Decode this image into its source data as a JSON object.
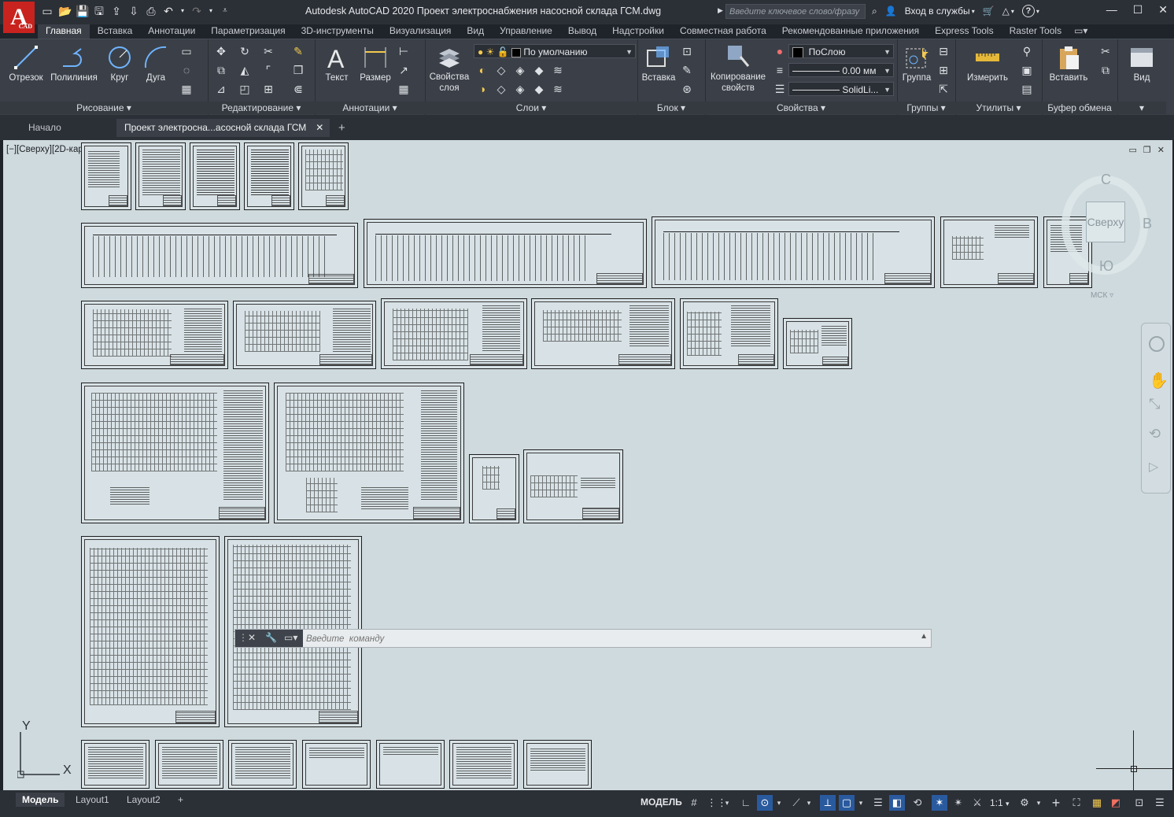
{
  "app": {
    "logo_letter": "A",
    "logo_sub": "CAD",
    "title": "Autodesk AutoCAD 2020   Проект электроснабжения насосной склада ГСМ.dwg",
    "search_placeholder": "Введите ключевое слово/фразу",
    "signin": "Вход в службы",
    "accent": "#2a5a9e"
  },
  "ribbon_tabs": [
    "Главная",
    "Вставка",
    "Аннотации",
    "Параметризация",
    "3D-инструменты",
    "Визуализация",
    "Вид",
    "Управление",
    "Вывод",
    "Надстройки",
    "Совместная работа",
    "Рекомендованные приложения",
    "Express Tools",
    "Raster Tools"
  ],
  "panels": {
    "draw": {
      "title": "Рисование",
      "line": "Отрезок",
      "polyline": "Полилиния",
      "circle": "Круг",
      "arc": "Дуга"
    },
    "modify": {
      "title": "Редактирование"
    },
    "annotation": {
      "title": "Аннотации",
      "text": "Текст",
      "dimension": "Размер"
    },
    "layers": {
      "title": "Слои",
      "layer_props_1": "Свойства",
      "layer_props_2": "слоя",
      "current_layer": "По умолчанию"
    },
    "block": {
      "title": "Блок",
      "insert": "Вставка"
    },
    "properties": {
      "title": "Свойства",
      "match_1": "Копирование",
      "match_2": "свойств",
      "color": "ПоСлою",
      "lineweight": "0.00 мм",
      "linetype": "SolidLi..."
    },
    "groups": {
      "title": "Группы",
      "group": "Группа"
    },
    "utilities": {
      "title": "Утилиты",
      "measure": "Измерить"
    },
    "clipboard": {
      "title": "Буфер обмена",
      "paste": "Вставить"
    },
    "view": {
      "title": "Вид"
    }
  },
  "doc_tabs": {
    "start": "Начало",
    "file": "Проект электросна...асосной склада ГСМ"
  },
  "viewport": {
    "label": "[−][Сверху][2D-каркас]",
    "navcube": {
      "north": "С",
      "south": "Ю",
      "east": "В",
      "face": "Сверху",
      "ucs": "МСК"
    },
    "ucs_x": "X",
    "ucs_y": "Y"
  },
  "command": {
    "placeholder": "Введите  команду"
  },
  "status": {
    "tabs": [
      "Модель",
      "Layout1",
      "Layout2"
    ],
    "model_label": "МОДЕЛЬ",
    "scale": "1:1"
  }
}
